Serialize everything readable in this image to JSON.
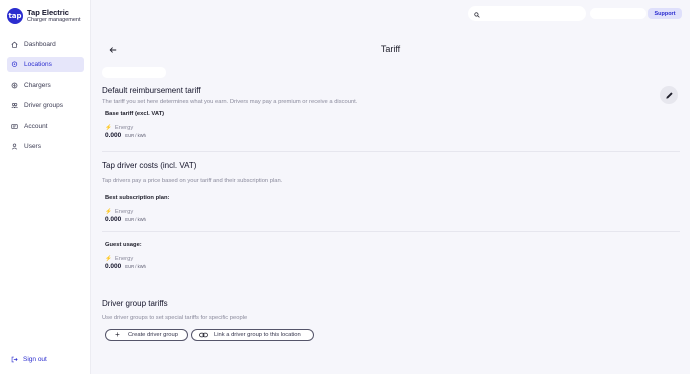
{
  "brand": {
    "logo_text": "tap",
    "name": "Tap Electric",
    "subtitle": "Charger management"
  },
  "sidebar": {
    "items": [
      {
        "label": "Dashboard",
        "icon": "home-icon"
      },
      {
        "label": "Locations",
        "icon": "location-pin-icon",
        "active": true
      },
      {
        "label": "Chargers",
        "icon": "charger-icon"
      },
      {
        "label": "Driver groups",
        "icon": "users-group-icon"
      },
      {
        "label": "Account",
        "icon": "account-card-icon"
      },
      {
        "label": "Users",
        "icon": "user-icon"
      }
    ],
    "signout_label": "Sign out"
  },
  "topbar": {
    "search_placeholder": "",
    "support_label": "Support"
  },
  "page": {
    "title": "Tariff"
  },
  "default_tariff": {
    "title": "Default reimbursement tariff",
    "description": "The tariff you set here determines what you earn. Drivers may pay a premium or receive a discount.",
    "base_label": "Base tariff (excl. VAT)",
    "energy_label": "Energy",
    "price": "0.000",
    "unit": "EUR / kWh"
  },
  "driver_costs": {
    "title": "Tap driver costs (incl. VAT)",
    "description": "Tap drivers pay a price based on your tariff and their subscription plan.",
    "best": {
      "label": "Best subscription plan:",
      "energy_label": "Energy",
      "price": "0.000",
      "unit": "EUR / kWh"
    },
    "guest": {
      "label": "Guest usage:",
      "energy_label": "Energy",
      "price": "0.000",
      "unit": "EUR / kWh"
    }
  },
  "driver_group_tariffs": {
    "title": "Driver group tariffs",
    "description": "Use driver groups to set special tariffs for specific people",
    "create_label": "Create driver group",
    "link_label": "Link a driver group to this location"
  },
  "colors": {
    "accent": "#2b2dcf",
    "active_bg": "#e6e6fa",
    "background": "#f6f6fb"
  }
}
